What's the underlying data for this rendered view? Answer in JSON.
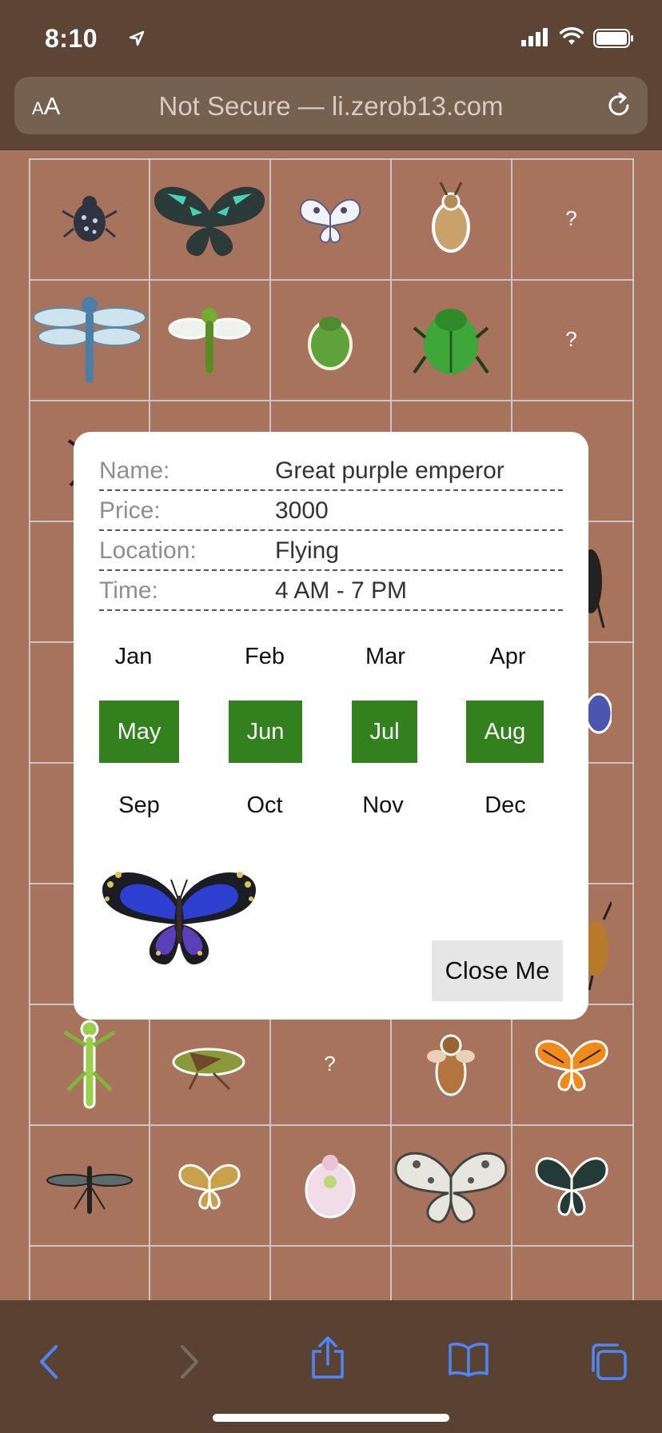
{
  "status": {
    "time": "8:10"
  },
  "browser": {
    "text_size_small": "A",
    "text_size_large": "A",
    "url": "Not Secure — li.zerob13.com"
  },
  "grid": {
    "unknown_mark": "?"
  },
  "modal": {
    "fields": [
      {
        "label": "Name:",
        "value": "Great purple emperor"
      },
      {
        "label": "Price:",
        "value": "3000"
      },
      {
        "label": "Location:",
        "value": "Flying"
      },
      {
        "label": "Time:",
        "value": "4 AM - 7 PM"
      }
    ],
    "months": [
      {
        "label": "Jan",
        "active": false
      },
      {
        "label": "Feb",
        "active": false
      },
      {
        "label": "Mar",
        "active": false
      },
      {
        "label": "Apr",
        "active": false
      },
      {
        "label": "May",
        "active": true
      },
      {
        "label": "Jun",
        "active": true
      },
      {
        "label": "Jul",
        "active": true
      },
      {
        "label": "Aug",
        "active": true
      },
      {
        "label": "Sep",
        "active": false
      },
      {
        "label": "Oct",
        "active": false
      },
      {
        "label": "Nov",
        "active": false
      },
      {
        "label": "Dec",
        "active": false
      }
    ],
    "close_label": "Close Me"
  },
  "colors": {
    "background": "#a8735c",
    "active_month": "#33801f",
    "toolbar": "#5a4232",
    "toolbar_icon": "#4f86f7"
  },
  "icons": {
    "back": "chevron-left-icon",
    "forward": "chevron-right-icon",
    "share": "share-icon",
    "bookmarks": "book-icon",
    "tabs": "tabs-icon"
  }
}
